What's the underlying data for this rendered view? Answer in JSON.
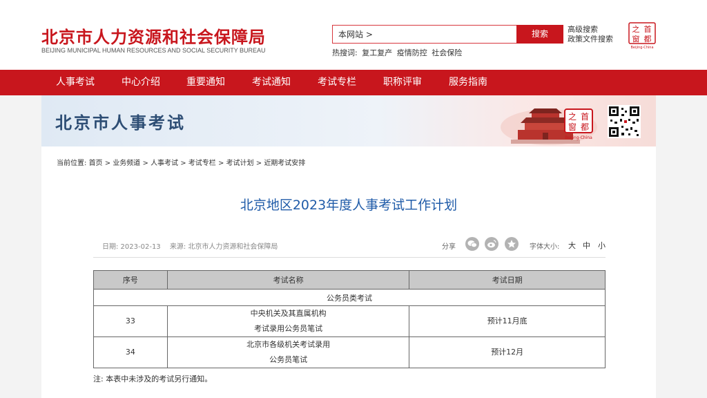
{
  "header": {
    "title": "北京市人力资源和社会保障局",
    "subtitle": "BEIJING MUNICIPAL HUMAN RESOURCES AND SOCIAL SECURITY BUREAU",
    "search": {
      "value": "本网站 >",
      "button": "搜索"
    },
    "advanced_search": "高级搜索",
    "policy_search": "政策文件搜索",
    "hot_label": "热搜词:",
    "hot_words": [
      "复工复产",
      "疫情防控",
      "社会保险"
    ],
    "logo_text": "Beijing-China"
  },
  "nav": [
    "人事考试",
    "中心介绍",
    "重要通知",
    "考试通知",
    "考试专栏",
    "职称评审",
    "服务指南"
  ],
  "banner": {
    "title": "北京市人事考试",
    "seal_text": "Beijing-China"
  },
  "breadcrumb": {
    "label": "当前位置:",
    "items": [
      "首页",
      "业务频道",
      "人事考试",
      "考试专栏",
      "考试计划",
      "近期考试安排"
    ]
  },
  "article": {
    "title": "北京地区2023年度人事考试工作计划",
    "date": "日期: 2023-02-13",
    "source": "来源: 北京市人力资源和社会保障局",
    "share_label": "分享",
    "share_icons": [
      "wechat-icon",
      "weibo-icon",
      "favorite-icon"
    ],
    "font_size_label": "字体大小:",
    "font_sizes": [
      "大",
      "中",
      "小"
    ]
  },
  "table": {
    "headers": [
      "序号",
      "考试名称",
      "考试日期"
    ],
    "section": "公务员类考试",
    "rows": [
      {
        "no": "33",
        "name_line1": "中央机关及其直属机构",
        "name_line2": "考试录用公务员笔试",
        "date": "预计11月底"
      },
      {
        "no": "34",
        "name_line1": "北京市各级机关考试录用",
        "name_line2": "公务员笔试",
        "date": "预计12月"
      }
    ]
  },
  "note": "注: 本表中未涉及的考试另行通知。",
  "colors": {
    "brand_red": "#c8161d",
    "title_blue": "#1f5ba8",
    "banner_blue": "#2d4d74"
  }
}
